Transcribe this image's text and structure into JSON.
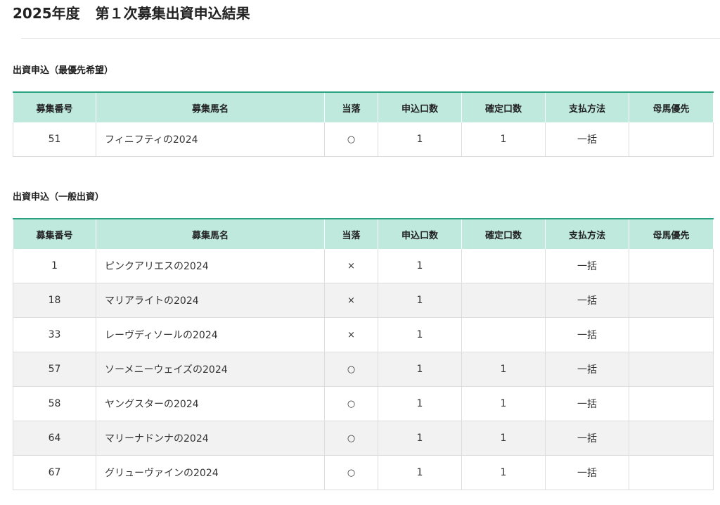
{
  "page": {
    "title_year": "2025年度",
    "title_main": "第１次募集出資申込結果"
  },
  "columns": {
    "number": "募集番号",
    "horse_name": "募集馬名",
    "result": "当落",
    "applied_units": "申込口数",
    "confirmed_units": "確定口数",
    "payment": "支払方法",
    "dam_priority": "母馬優先"
  },
  "priority_section": {
    "heading": "出資申込（最優先希望）",
    "rows": [
      {
        "number": "51",
        "horse_name": "フィニフティの2024",
        "result": "○",
        "applied_units": "1",
        "confirmed_units": "1",
        "payment": "一括",
        "dam_priority": ""
      }
    ]
  },
  "general_section": {
    "heading": "出資申込（一般出資）",
    "rows": [
      {
        "number": "1",
        "horse_name": "ピンクアリエスの2024",
        "result": "×",
        "applied_units": "1",
        "confirmed_units": "",
        "payment": "一括",
        "dam_priority": ""
      },
      {
        "number": "18",
        "horse_name": "マリアライトの2024",
        "result": "×",
        "applied_units": "1",
        "confirmed_units": "",
        "payment": "一括",
        "dam_priority": ""
      },
      {
        "number": "33",
        "horse_name": "レーヴディソールの2024",
        "result": "×",
        "applied_units": "1",
        "confirmed_units": "",
        "payment": "一括",
        "dam_priority": ""
      },
      {
        "number": "57",
        "horse_name": "ソーメニーウェイズの2024",
        "result": "○",
        "applied_units": "1",
        "confirmed_units": "1",
        "payment": "一括",
        "dam_priority": ""
      },
      {
        "number": "58",
        "horse_name": "ヤングスターの2024",
        "result": "○",
        "applied_units": "1",
        "confirmed_units": "1",
        "payment": "一括",
        "dam_priority": ""
      },
      {
        "number": "64",
        "horse_name": "マリーナドンナの2024",
        "result": "○",
        "applied_units": "1",
        "confirmed_units": "1",
        "payment": "一括",
        "dam_priority": ""
      },
      {
        "number": "67",
        "horse_name": "グリューヴァインの2024",
        "result": "○",
        "applied_units": "1",
        "confirmed_units": "1",
        "payment": "一括",
        "dam_priority": ""
      }
    ]
  }
}
